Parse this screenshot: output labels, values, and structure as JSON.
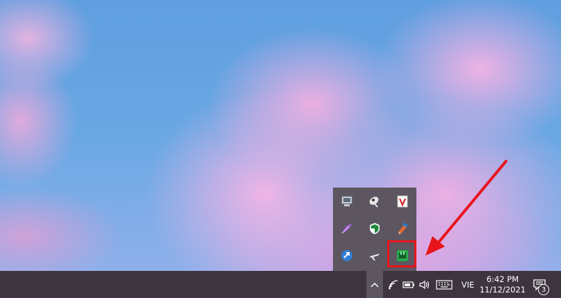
{
  "tray_overflow": {
    "icons": [
      {
        "name": "display-monitor-icon"
      },
      {
        "name": "satellite-dish-icon"
      },
      {
        "name": "v-app-icon"
      },
      {
        "name": "feather-pen-icon"
      },
      {
        "name": "security-shield-icon"
      },
      {
        "name": "ccleaner-icon"
      },
      {
        "name": "blue-app-icon"
      },
      {
        "name": "airplane-icon"
      },
      {
        "name": "green-app-icon",
        "highlighted": true
      }
    ]
  },
  "annotation": {
    "color": "#e8141c"
  },
  "taskbar": {
    "language": "VIE",
    "time": "6:42 PM",
    "date": "11/12/2021",
    "notification_count": "3"
  }
}
